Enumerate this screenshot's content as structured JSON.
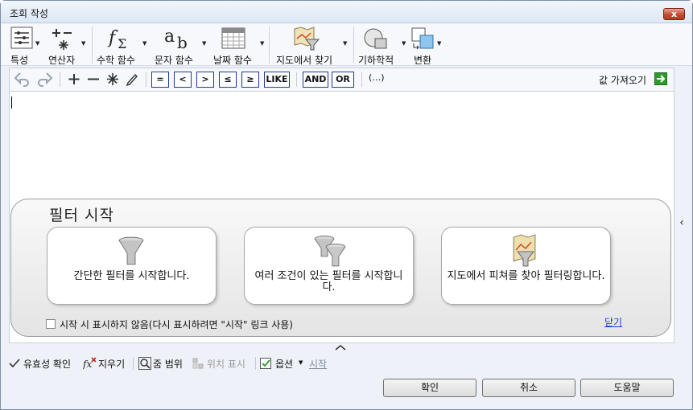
{
  "window": {
    "title": "조회 작성",
    "close_glyph": "x"
  },
  "ribbon": {
    "items": [
      {
        "label": "특성",
        "icon": "properties-list-icon"
      },
      {
        "label": "연산자",
        "icon": "operators-icon"
      },
      {
        "label": "수학 함수",
        "icon": "math-function-icon"
      },
      {
        "label": "문자 함수",
        "icon": "string-function-icon"
      },
      {
        "label": "날짜 함수",
        "icon": "date-function-icon"
      },
      {
        "label": "지도에서 찾기",
        "icon": "map-filter-icon"
      },
      {
        "label": "기하학적",
        "icon": "geometric-icon"
      },
      {
        "label": "변환",
        "icon": "transform-icon"
      }
    ]
  },
  "editbar": {
    "operators": [
      "=",
      "<",
      ">",
      "≤",
      "≥",
      "LIKE"
    ],
    "logic": [
      "AND",
      "OR"
    ],
    "paren": "(…)",
    "get_values": "값 가져오기"
  },
  "filter_panel": {
    "title": "필터 시작",
    "cards": [
      {
        "text": "간단한 필터를 시작합니다.",
        "icon": "funnel-icon"
      },
      {
        "text": "여러 조건이 있는 필터를 시작합니다.",
        "icon": "double-funnel-icon"
      },
      {
        "text": "지도에서 피쳐를 찾아 필터링합니다.",
        "icon": "map-funnel-icon"
      }
    ],
    "checkbox_label": "시작 시 표시하지 않음(다시 표시하려면 \"시작\" 링크 사용)",
    "checkbox_checked": false,
    "close_link": "닫기"
  },
  "statusbar": {
    "validate": "유효성 확인",
    "clear": "지우기",
    "zoom_range": "줌 범위",
    "show_location": "위치 표시",
    "options": "옵션",
    "start": "시작"
  },
  "buttons": {
    "ok": "확인",
    "cancel": "취소",
    "help": "도움말"
  },
  "colors": {
    "accent": "#1c3fd6",
    "operator_border": "#203a8a",
    "arrow_green": "#2e9a2e"
  }
}
